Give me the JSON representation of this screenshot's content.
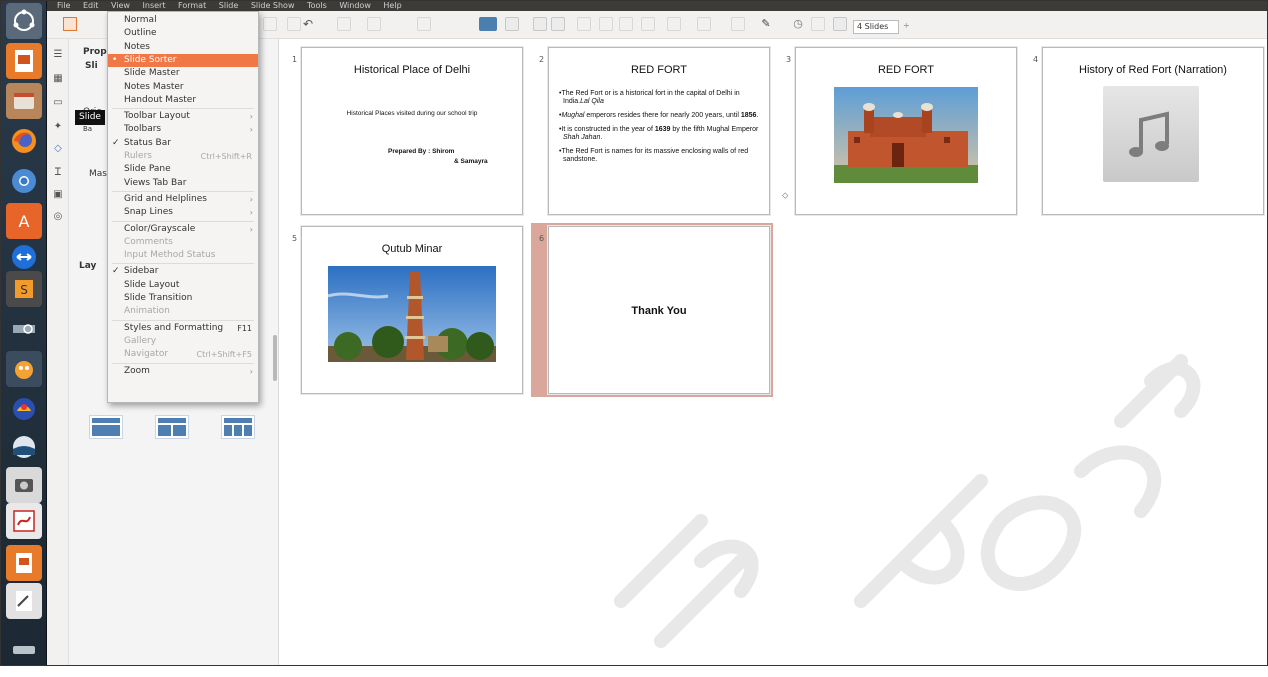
{
  "menubar": {
    "items": [
      "File",
      "Edit",
      "View",
      "Insert",
      "Format",
      "Slide",
      "Slide Show",
      "Tools",
      "Window",
      "Help"
    ]
  },
  "toolbar": {
    "slides_count_label": "4 Slides",
    "spin_glyph": "÷"
  },
  "sidebar": {
    "properties_title": "Prop",
    "slide_section": "Sli",
    "orientation_label": "Orie",
    "background_label": "Ba",
    "master_label": "Mas",
    "layouts_section": "Lay",
    "tooltip": "Slide"
  },
  "view_menu": {
    "items": [
      {
        "label": "Normal",
        "state": "normal"
      },
      {
        "label": "Outline",
        "state": "normal"
      },
      {
        "label": "Notes",
        "state": "normal"
      },
      {
        "label": "Slide Sorter",
        "state": "selected",
        "mark": "•"
      },
      {
        "label": "Slide Master",
        "state": "normal"
      },
      {
        "label": "Notes Master",
        "state": "normal"
      },
      {
        "label": "Handout Master",
        "state": "normal"
      },
      {
        "label": "Toolbar Layout",
        "state": "normal",
        "submenu": true
      },
      {
        "label": "Toolbars",
        "state": "normal",
        "submenu": true
      },
      {
        "label": "Status Bar",
        "state": "normal",
        "mark": "✓"
      },
      {
        "label": "Rulers",
        "state": "disabled",
        "accel": "Ctrl+Shift+R"
      },
      {
        "label": "Slide Pane",
        "state": "normal"
      },
      {
        "label": "Views Tab Bar",
        "state": "normal"
      },
      {
        "label": "Grid and Helplines",
        "state": "normal",
        "submenu": true
      },
      {
        "label": "Snap Lines",
        "state": "normal",
        "submenu": true
      },
      {
        "label": "Color/Grayscale",
        "state": "normal",
        "submenu": true
      },
      {
        "label": "Comments",
        "state": "disabled"
      },
      {
        "label": "Input Method Status",
        "state": "disabled"
      },
      {
        "label": "Sidebar",
        "state": "normal",
        "mark": "✓"
      },
      {
        "label": "Slide Layout",
        "state": "normal"
      },
      {
        "label": "Slide Transition",
        "state": "normal"
      },
      {
        "label": "Animation",
        "state": "disabled"
      },
      {
        "label": "Styles and Formatting",
        "state": "normal",
        "accel": "F11"
      },
      {
        "label": "Gallery",
        "state": "disabled"
      },
      {
        "label": "Navigator",
        "state": "disabled",
        "accel": "Ctrl+Shift+F5"
      },
      {
        "label": "Zoom",
        "state": "normal",
        "submenu": true
      }
    ]
  },
  "slides": [
    {
      "number": "1",
      "title": "Historical Place of Delhi",
      "subtitle": "Historical Places visited during our school trip",
      "prepared_by": "Prepared By : Shirom",
      "prepared_by_2": "& Samayra"
    },
    {
      "number": "2",
      "title": "RED FORT",
      "bullets": [
        {
          "pre": "The Red Fort or ",
          "em": "Lal Qila",
          "post": " is a historical fort in the capital of Delhi in India."
        },
        {
          "em": "Mughal",
          "post": " emperors resides there for nearly 200 years, until ",
          "strong": "1856",
          "tail": "."
        },
        {
          "pre": "It is constructed in the year of ",
          "strong": "1639",
          "post": " by the fifth Mughal Emperor ",
          "em": "Shah Jahan",
          "tail": "."
        },
        {
          "pre": "The Red Fort is names for its massive enclosing walls of red sandstone."
        }
      ]
    },
    {
      "number": "3",
      "title": "RED FORT"
    },
    {
      "number": "4",
      "title": "History of Red Fort (Narration)"
    },
    {
      "number": "5",
      "title": "Qutub Minar"
    },
    {
      "number": "6",
      "title": "Thank You"
    }
  ],
  "colors": {
    "menu_highlight": "#f07746",
    "selected_slide_halo": "#d9a79b",
    "launcher_bg": "#1c2833"
  },
  "icons": {
    "launcher": [
      "ubuntu-dash-icon",
      "impress-icon",
      "files-icon",
      "firefox-icon",
      "chromium-icon",
      "software-center-icon",
      "teamviewer-icon",
      "sublime-icon",
      "screen-ruler-icon",
      "scratch-icon",
      "game-icon",
      "stellarium-icon",
      "camera-icon",
      "draw-icon",
      "impress-doc-icon",
      "text-editor-icon",
      "drive-icon"
    ]
  }
}
